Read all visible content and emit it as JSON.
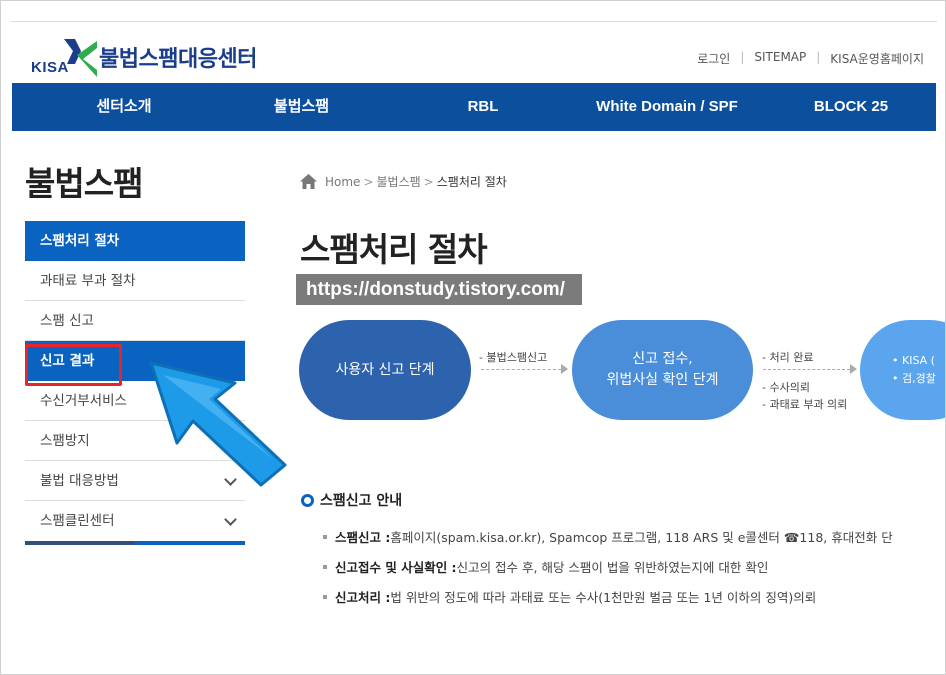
{
  "header": {
    "logo_kisa": "KISA",
    "logo_title": "불법스팸대응센터",
    "util_links": [
      "로그인",
      "SITEMAP",
      "KISA운영홈페이지"
    ]
  },
  "nav": {
    "items": [
      "센터소개",
      "불법스팸",
      "RBL",
      "White Domain / SPF",
      "BLOCK 25"
    ]
  },
  "sidebar": {
    "title": "불법스팸",
    "items": [
      {
        "label": "스팸처리 절차"
      },
      {
        "label": "과태료 부과 절차"
      },
      {
        "label": "스팸 신고"
      },
      {
        "label": "신고 결과"
      },
      {
        "label": "수신거부서비스"
      },
      {
        "label": "스팸방지"
      },
      {
        "label": "불법 대응방법"
      },
      {
        "label": "스팸클린센터"
      }
    ]
  },
  "breadcrumb": {
    "home": "Home",
    "level1": "불법스팸",
    "current": "스팸처리 절차"
  },
  "page": {
    "title": "스팸처리 절차",
    "watermark": "https://donstudy.tistory.com/"
  },
  "flow": {
    "step1": "사용자 신고 단계",
    "step2_line1": "신고 접수,",
    "step2_line2": "위법사실 확인 단계",
    "step3_line1": "• KISA (",
    "step3_line2": "• 검,경찰",
    "label1": "- 불법스팸신고",
    "label2": "- 처리 완료",
    "label3": "- 수사의뢰",
    "label4": "- 과태료 부과 의뢰"
  },
  "guide": {
    "heading": "스팸신고 안내",
    "rows": [
      {
        "term": "스팸신고 :",
        "desc": " 홈페이지(spam.kisa.or.kr), Spamcop 프로그램, 118 ARS 및 e콜센터 ☎118, 휴대전화 단"
      },
      {
        "term": "신고접수 및 사실확인 :",
        "desc": " 신고의 접수 후, 해당 스팸이 법을 위반하였는지에 대한 확인"
      },
      {
        "term": "신고처리 :",
        "desc": " 법 위반의 정도에 따라 과태료 또는 수사(1천만원 벌금 또는 1년 이하의 징역)의뢰"
      }
    ]
  },
  "colors": {
    "nav_bg": "#0c4f9d",
    "active_bg": "#0a63c1",
    "highlight_border": "#e8242b",
    "arrow": "#1e9be8"
  }
}
